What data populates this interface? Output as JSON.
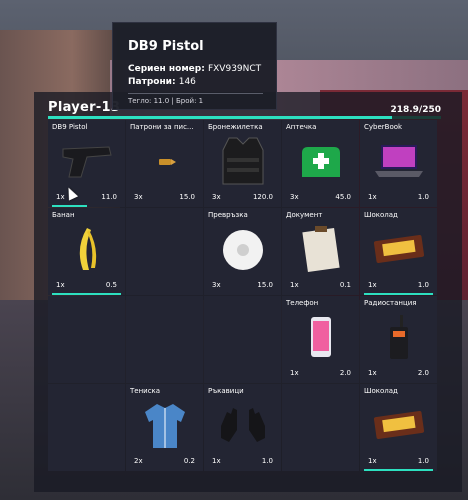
{
  "tooltip": {
    "title": "DB9 Pistol",
    "serial_label": "Сериен номер:",
    "serial_value": "FXV939NCT",
    "ammo_label": "Патрони:",
    "ammo_value": "146",
    "footer": "Тегло: 11.0 | Брой: 1"
  },
  "inventory": {
    "player": "Player-13",
    "weight_text": "218.9/250",
    "weight_fraction": 0.876,
    "accent": "#2de0c0",
    "slots": [
      {
        "name": "DB9 Pistol",
        "qty": "1x",
        "weight": "11.0",
        "icon": "pistol-icon",
        "durability": 0.5
      },
      {
        "name": "Патрони за пис...",
        "qty": "3x",
        "weight": "15.0",
        "icon": "bullet-icon"
      },
      {
        "name": "Бронежилетка",
        "qty": "3x",
        "weight": "120.0",
        "icon": "vest-icon"
      },
      {
        "name": "Аптечка",
        "qty": "3x",
        "weight": "45.0",
        "icon": "medkit-icon"
      },
      {
        "name": "CyberBook",
        "qty": "1x",
        "weight": "1.0",
        "icon": "laptop-icon"
      },
      {
        "name": "Банан",
        "qty": "1x",
        "weight": "0.5",
        "icon": "banana-icon",
        "durability": 1
      },
      {
        "name": "",
        "qty": "",
        "weight": "",
        "icon": ""
      },
      {
        "name": "Превръзка",
        "qty": "3x",
        "weight": "15.0",
        "icon": "bandage-icon"
      },
      {
        "name": "Документ",
        "qty": "1x",
        "weight": "0.1",
        "icon": "document-icon"
      },
      {
        "name": "Шоколад",
        "qty": "1x",
        "weight": "1.0",
        "icon": "chocolate-icon",
        "durability": 1
      },
      {
        "name": "",
        "qty": "",
        "weight": "",
        "icon": ""
      },
      {
        "name": "",
        "qty": "",
        "weight": "",
        "icon": ""
      },
      {
        "name": "",
        "qty": "",
        "weight": "",
        "icon": ""
      },
      {
        "name": "Телефон",
        "qty": "1x",
        "weight": "2.0",
        "icon": "phone-icon"
      },
      {
        "name": "Радиостанция",
        "qty": "1x",
        "weight": "2.0",
        "icon": "radio-icon"
      },
      {
        "name": "",
        "qty": "",
        "weight": "",
        "icon": ""
      },
      {
        "name": "Тениска",
        "qty": "2x",
        "weight": "0.2",
        "icon": "shirt-icon"
      },
      {
        "name": "Ръкавици",
        "qty": "1x",
        "weight": "1.0",
        "icon": "gloves-icon"
      },
      {
        "name": "",
        "qty": "",
        "weight": "",
        "icon": ""
      },
      {
        "name": "Шоколад",
        "qty": "1x",
        "weight": "1.0",
        "icon": "chocolate-icon",
        "durability": 1
      }
    ]
  }
}
